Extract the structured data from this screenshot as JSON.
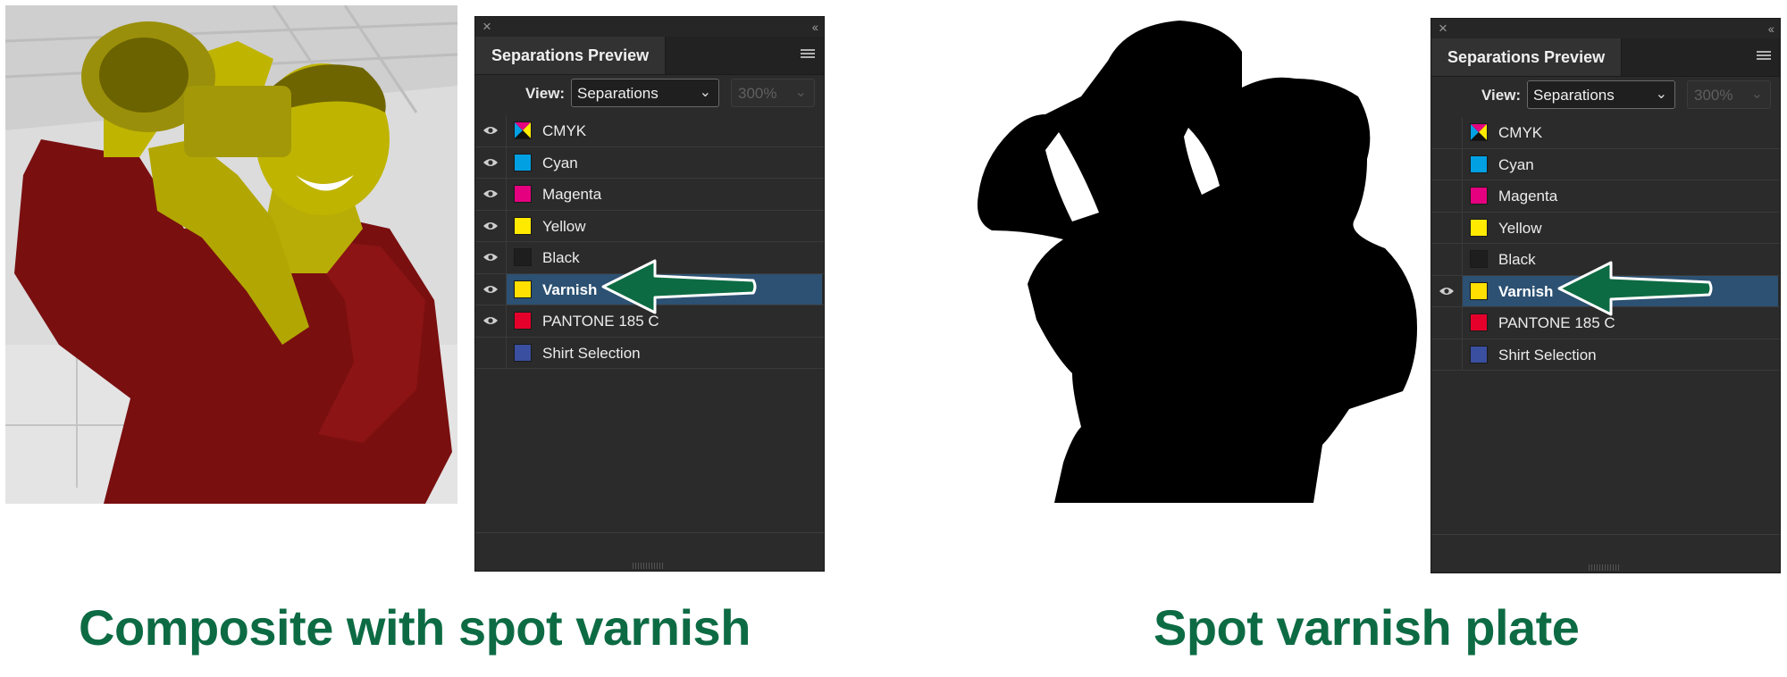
{
  "panels": [
    {
      "title": "Separations Preview",
      "view_label": "View:",
      "view_value": "Separations",
      "zoom_value": "300%",
      "rows": [
        {
          "label": "CMYK",
          "color": "cmyk",
          "eye": true,
          "selected": false
        },
        {
          "label": "Cyan",
          "color": "#00a0e3",
          "eye": true,
          "selected": false
        },
        {
          "label": "Magenta",
          "color": "#e4007e",
          "eye": true,
          "selected": false
        },
        {
          "label": "Yellow",
          "color": "#ffea00",
          "eye": true,
          "selected": false
        },
        {
          "label": "Black",
          "color": "#1e1e1e",
          "eye": true,
          "selected": false
        },
        {
          "label": "Varnish",
          "color": "#ffe000",
          "eye": true,
          "selected": true
        },
        {
          "label": "PANTONE 185 C",
          "color": "#e4002b",
          "eye": true,
          "selected": false
        },
        {
          "label": "Shirt Selection",
          "color": "#3a4fa0",
          "eye": false,
          "selected": false
        }
      ]
    },
    {
      "title": "Separations Preview",
      "view_label": "View:",
      "view_value": "Separations",
      "zoom_value": "300%",
      "rows": [
        {
          "label": "CMYK",
          "color": "cmyk",
          "eye": false,
          "selected": false
        },
        {
          "label": "Cyan",
          "color": "#00a0e3",
          "eye": false,
          "selected": false
        },
        {
          "label": "Magenta",
          "color": "#e4007e",
          "eye": false,
          "selected": false
        },
        {
          "label": "Yellow",
          "color": "#ffea00",
          "eye": false,
          "selected": false
        },
        {
          "label": "Black",
          "color": "#1e1e1e",
          "eye": false,
          "selected": false
        },
        {
          "label": "Varnish",
          "color": "#ffe000",
          "eye": true,
          "selected": true
        },
        {
          "label": "PANTONE 185 C",
          "color": "#e4002b",
          "eye": false,
          "selected": false
        },
        {
          "label": "Shirt Selection",
          "color": "#3a4fa0",
          "eye": false,
          "selected": false
        }
      ]
    }
  ],
  "captions": {
    "left": "Composite with spot varnish",
    "right": "Spot varnish plate"
  },
  "colors": {
    "caption": "#0d6b44",
    "arrow": "#0d6b44",
    "selected_row": "#2c5172",
    "varnish_tint": "#bfb400",
    "shirt": "#7a0f10"
  }
}
